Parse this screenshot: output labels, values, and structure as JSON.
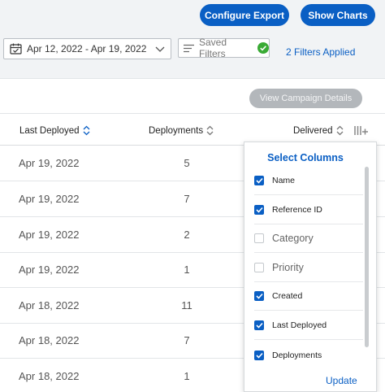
{
  "header": {
    "configure_export": "Configure Export",
    "show_charts": "Show Charts"
  },
  "filters": {
    "date_range": "Apr 12, 2022 - Apr 19, 2022",
    "saved_filters": "Saved Filters",
    "applied": "2 Filters Applied"
  },
  "toolbar": {
    "view_campaign_details": "View Campaign Details"
  },
  "table": {
    "columns": [
      "Last Deployed",
      "Deployments",
      "Delivered"
    ],
    "rows": [
      {
        "last_deployed": "Apr 19, 2022",
        "deployments": "5"
      },
      {
        "last_deployed": "Apr 19, 2022",
        "deployments": "7"
      },
      {
        "last_deployed": "Apr 19, 2022",
        "deployments": "2"
      },
      {
        "last_deployed": "Apr 19, 2022",
        "deployments": "1"
      },
      {
        "last_deployed": "Apr 18, 2022",
        "deployments": "11"
      },
      {
        "last_deployed": "Apr 18, 2022",
        "deployments": "7"
      },
      {
        "last_deployed": "Apr 18, 2022",
        "deployments": "1"
      }
    ]
  },
  "select_columns": {
    "title": "Select Columns",
    "items": [
      {
        "label": "Name",
        "checked": true
      },
      {
        "label": "Reference ID",
        "checked": true
      },
      {
        "label": "Category",
        "checked": false
      },
      {
        "label": "Priority",
        "checked": false
      },
      {
        "label": "Created",
        "checked": true
      },
      {
        "label": "Last Deployed",
        "checked": true
      },
      {
        "label": "Deployments",
        "checked": true
      }
    ],
    "update": "Update"
  },
  "colors": {
    "accent": "#0a5fc4",
    "disabled_button": "#b3b7bb",
    "check_green": "#3aaa35"
  },
  "icons": {
    "calendar": "calendar-icon",
    "chevron": "chevron-down-icon",
    "filter_lines": "filter-lines-icon",
    "check_circle": "check-circle-icon",
    "sort": "sort-icon",
    "add_column": "add-column-icon"
  }
}
